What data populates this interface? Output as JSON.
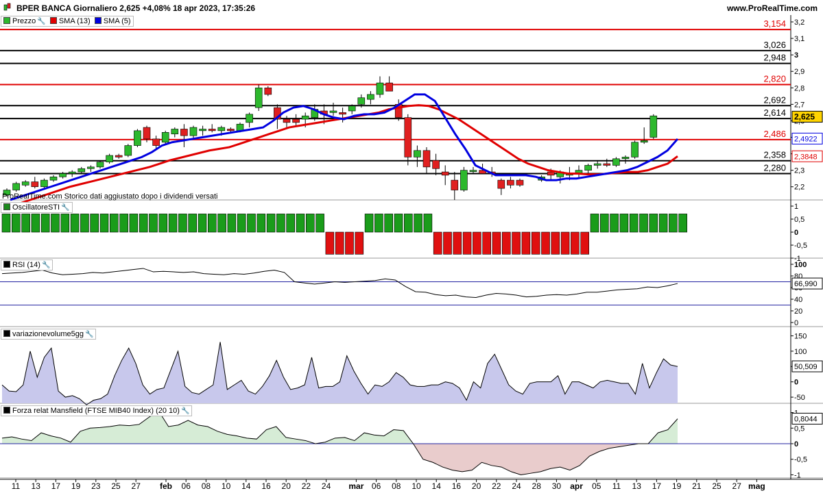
{
  "header": {
    "title": "BPER BANCA Giornaliero 2,625 +4,08% 18 apr 2023, 17:35:26",
    "site": "www.ProRealTime.com"
  },
  "price_panel": {
    "legend": [
      {
        "label": "Prezzo",
        "color": "#1b8a1b"
      },
      {
        "label": "SMA (13)",
        "color": "#e00000"
      },
      {
        "label": "SMA (5)",
        "color": "#0000e0"
      }
    ],
    "note": "ProRealTime.com Storico dati aggiustato dopo i dividendi versati",
    "levels": [
      {
        "value": 3.154,
        "label": "3,154",
        "color": "#e00000"
      },
      {
        "value": 3.026,
        "label": "3,026",
        "color": "#000000"
      },
      {
        "value": 2.948,
        "label": "2,948",
        "color": "#000000"
      },
      {
        "value": 2.82,
        "label": "2,820",
        "color": "#e00000"
      },
      {
        "value": 2.692,
        "label": "2,692",
        "color": "#000000"
      },
      {
        "value": 2.614,
        "label": "2,614",
        "color": "#000000"
      },
      {
        "value": 2.486,
        "label": "2,486",
        "color": "#e00000"
      },
      {
        "value": 2.358,
        "label": "2,358",
        "color": "#000000"
      },
      {
        "value": 2.28,
        "label": "2,280",
        "color": "#000000"
      }
    ],
    "y_ticks": [
      "3,2",
      "3,1",
      "3",
      "2,9",
      "2,8",
      "2,7",
      "2,6",
      "2,5",
      "2,4",
      "2,3",
      "2,2"
    ],
    "y_tick_values": [
      3.2,
      3.1,
      3.0,
      2.9,
      2.8,
      2.7,
      2.6,
      2.5,
      2.4,
      2.3,
      2.2
    ],
    "badges": [
      {
        "label": "2,625",
        "value": 2.625,
        "kind": "price"
      },
      {
        "label": "2,4922",
        "value": 2.4922,
        "kind": "sma5"
      },
      {
        "label": "2,3848",
        "value": 2.3848,
        "kind": "sma13"
      }
    ]
  },
  "sti_panel": {
    "legend": "OscillatoreSTI",
    "y_ticks": [
      "1",
      "0,5",
      "0",
      "-0,5",
      "-1"
    ],
    "y_tick_values": [
      1,
      0.5,
      0,
      -0.5,
      -1
    ]
  },
  "rsi_panel": {
    "legend": "RSI (14)",
    "y_ticks": [
      "100",
      "80",
      "60",
      "40",
      "20",
      "0"
    ],
    "y_tick_values": [
      100,
      80,
      60,
      40,
      20,
      0
    ],
    "badge": "66,990",
    "badge_value": 66.99
  },
  "vol_panel": {
    "legend": "variazionevolume5gg",
    "y_ticks": [
      "150",
      "100",
      "50",
      "0",
      "-50"
    ],
    "y_tick_values": [
      150,
      100,
      50,
      0,
      -50
    ],
    "badge": "50,509",
    "badge_value": 50.509
  },
  "mansfield_panel": {
    "legend": "Forza relat Mansfield (FTSE MIB40 Index) (20 10)",
    "y_ticks": [
      "1",
      "0,5",
      "0",
      "-0,5",
      "-1"
    ],
    "y_tick_values": [
      1,
      0.5,
      0,
      -0.5,
      -1
    ],
    "badge": "0,8044",
    "badge_value": 0.8044
  },
  "x_axis": {
    "ticks": [
      {
        "label": "11",
        "i": 0
      },
      {
        "label": "13",
        "i": 2
      },
      {
        "label": "17",
        "i": 4
      },
      {
        "label": "19",
        "i": 6
      },
      {
        "label": "23",
        "i": 8
      },
      {
        "label": "25",
        "i": 10
      },
      {
        "label": "27",
        "i": 12
      },
      {
        "label": "feb",
        "i": 15,
        "bold": true
      },
      {
        "label": "06",
        "i": 17
      },
      {
        "label": "08",
        "i": 19
      },
      {
        "label": "10",
        "i": 21
      },
      {
        "label": "14",
        "i": 23
      },
      {
        "label": "16",
        "i": 25
      },
      {
        "label": "20",
        "i": 27
      },
      {
        "label": "22",
        "i": 29
      },
      {
        "label": "24",
        "i": 31
      },
      {
        "label": "mar",
        "i": 34,
        "bold": true
      },
      {
        "label": "06",
        "i": 36
      },
      {
        "label": "08",
        "i": 38
      },
      {
        "label": "10",
        "i": 40
      },
      {
        "label": "14",
        "i": 42
      },
      {
        "label": "16",
        "i": 44
      },
      {
        "label": "20",
        "i": 46
      },
      {
        "label": "22",
        "i": 48
      },
      {
        "label": "24",
        "i": 50
      },
      {
        "label": "28",
        "i": 52
      },
      {
        "label": "30",
        "i": 54
      },
      {
        "label": "apr",
        "i": 56,
        "bold": true
      },
      {
        "label": "05",
        "i": 58
      },
      {
        "label": "11",
        "i": 60
      },
      {
        "label": "13",
        "i": 62
      },
      {
        "label": "17",
        "i": 64
      },
      {
        "label": "19",
        "i": 66
      },
      {
        "label": "21",
        "i": 68
      },
      {
        "label": "25",
        "i": 70
      },
      {
        "label": "27",
        "i": 72
      },
      {
        "label": "mag",
        "i": 74,
        "bold": true
      }
    ]
  },
  "colors": {
    "up": "#2db82d",
    "down": "#e02020",
    "sma13": "#e00000",
    "sma5": "#0000e0"
  },
  "chart_data": [
    {
      "type": "candlestick",
      "title": "BPER BANCA Giornaliero",
      "ylim": [
        2.12,
        3.2
      ],
      "ohlc": [
        [
          2.15,
          2.19,
          2.14,
          2.18
        ],
        [
          2.18,
          2.23,
          2.17,
          2.22
        ],
        [
          2.21,
          2.24,
          2.2,
          2.23
        ],
        [
          2.23,
          2.26,
          2.19,
          2.2
        ],
        [
          2.2,
          2.25,
          2.19,
          2.24
        ],
        [
          2.24,
          2.27,
          2.23,
          2.26
        ],
        [
          2.26,
          2.29,
          2.25,
          2.28
        ],
        [
          2.28,
          2.3,
          2.26,
          2.29
        ],
        [
          2.29,
          2.32,
          2.28,
          2.31
        ],
        [
          2.31,
          2.33,
          2.29,
          2.32
        ],
        [
          2.32,
          2.36,
          2.31,
          2.35
        ],
        [
          2.35,
          2.4,
          2.34,
          2.39
        ],
        [
          2.39,
          2.4,
          2.37,
          2.38
        ],
        [
          2.39,
          2.46,
          2.38,
          2.45
        ],
        [
          2.45,
          2.55,
          2.44,
          2.54
        ],
        [
          2.56,
          2.57,
          2.47,
          2.49
        ],
        [
          2.49,
          2.51,
          2.43,
          2.45
        ],
        [
          2.47,
          2.54,
          2.46,
          2.53
        ],
        [
          2.52,
          2.56,
          2.5,
          2.55
        ],
        [
          2.55,
          2.58,
          2.44,
          2.51
        ],
        [
          2.51,
          2.57,
          2.49,
          2.56
        ],
        [
          2.54,
          2.57,
          2.51,
          2.55
        ],
        [
          2.55,
          2.58,
          2.53,
          2.54
        ],
        [
          2.54,
          2.57,
          2.51,
          2.56
        ],
        [
          2.55,
          2.56,
          2.53,
          2.54
        ],
        [
          2.54,
          2.59,
          2.53,
          2.58
        ],
        [
          2.59,
          2.65,
          2.56,
          2.64
        ],
        [
          2.68,
          2.82,
          2.66,
          2.8
        ],
        [
          2.8,
          2.81,
          2.75,
          2.76
        ],
        [
          2.68,
          2.7,
          2.55,
          2.61
        ],
        [
          2.61,
          2.63,
          2.56,
          2.59
        ],
        [
          2.61,
          2.64,
          2.57,
          2.59
        ],
        [
          2.61,
          2.65,
          2.56,
          2.63
        ],
        [
          2.62,
          2.7,
          2.6,
          2.67
        ],
        [
          2.66,
          2.7,
          2.58,
          2.64
        ],
        [
          2.65,
          2.71,
          2.63,
          2.66
        ],
        [
          2.65,
          2.68,
          2.59,
          2.64
        ],
        [
          2.66,
          2.7,
          2.64,
          2.69
        ],
        [
          2.7,
          2.76,
          2.68,
          2.74
        ],
        [
          2.73,
          2.78,
          2.7,
          2.76
        ],
        [
          2.76,
          2.87,
          2.74,
          2.83
        ],
        [
          2.83,
          2.87,
          2.79,
          2.78
        ],
        [
          2.7,
          2.73,
          2.6,
          2.62
        ],
        [
          2.62,
          2.64,
          2.33,
          2.38
        ],
        [
          2.38,
          2.45,
          2.32,
          2.42
        ],
        [
          2.42,
          2.44,
          2.28,
          2.32
        ],
        [
          2.36,
          2.4,
          2.27,
          2.31
        ],
        [
          2.29,
          2.33,
          2.21,
          2.27
        ],
        [
          2.24,
          2.29,
          2.12,
          2.18
        ],
        [
          2.18,
          2.32,
          2.17,
          2.3
        ],
        [
          2.3,
          2.32,
          2.28,
          2.3
        ],
        [
          2.3,
          2.34,
          2.28,
          2.28
        ],
        [
          2.29,
          2.32,
          2.26,
          2.28
        ],
        [
          2.24,
          2.25,
          2.15,
          2.19
        ],
        [
          2.24,
          2.26,
          2.19,
          2.21
        ],
        [
          2.24,
          2.25,
          2.2,
          2.21
        ]
      ],
      "ohlc2": [
        [
          2.24,
          2.27,
          2.23,
          2.26
        ],
        [
          2.29,
          2.31,
          2.24,
          2.27
        ],
        [
          2.26,
          2.3,
          2.22,
          2.29
        ],
        [
          2.27,
          2.32,
          2.24,
          2.28
        ],
        [
          2.28,
          2.33,
          2.25,
          2.3
        ],
        [
          2.3,
          2.34,
          2.28,
          2.33
        ],
        [
          2.33,
          2.36,
          2.31,
          2.34
        ],
        [
          2.34,
          2.37,
          2.32,
          2.33
        ],
        [
          2.33,
          2.38,
          2.32,
          2.37
        ],
        [
          2.37,
          2.39,
          2.34,
          2.38
        ],
        [
          2.38,
          2.48,
          2.37,
          2.47
        ],
        [
          2.47,
          2.56,
          2.46,
          2.48
        ],
        [
          2.5,
          2.64,
          2.49,
          2.63
        ]
      ],
      "sma13": [
        2.08,
        2.1,
        2.12,
        2.14,
        2.16,
        2.18,
        2.2,
        2.215,
        2.23,
        2.245,
        2.26,
        2.275,
        2.29,
        2.305,
        2.32,
        2.34,
        2.36,
        2.375,
        2.39,
        2.405,
        2.42,
        2.43,
        2.44,
        2.46,
        2.48,
        2.5,
        2.52,
        2.54,
        2.56,
        2.57,
        2.58,
        2.59,
        2.6,
        2.61,
        2.62,
        2.63,
        2.64,
        2.65,
        2.67,
        2.68,
        2.69,
        2.695,
        2.69,
        2.67,
        2.64,
        2.61,
        2.57,
        2.53,
        2.49,
        2.45,
        2.41,
        2.37,
        2.34,
        2.32,
        2.3,
        2.29,
        2.28,
        2.28,
        2.275,
        2.275,
        2.28,
        2.285,
        2.29,
        2.29,
        2.3,
        2.32,
        2.34,
        2.385
      ],
      "sma5": [
        2.12,
        2.14,
        2.16,
        2.18,
        2.2,
        2.22,
        2.24,
        2.26,
        2.28,
        2.3,
        2.32,
        2.34,
        2.36,
        2.38,
        2.41,
        2.45,
        2.47,
        2.48,
        2.49,
        2.5,
        2.51,
        2.52,
        2.53,
        2.54,
        2.55,
        2.56,
        2.6,
        2.65,
        2.68,
        2.69,
        2.67,
        2.64,
        2.62,
        2.61,
        2.63,
        2.64,
        2.64,
        2.65,
        2.68,
        2.72,
        2.76,
        2.76,
        2.72,
        2.62,
        2.52,
        2.43,
        2.33,
        2.3,
        2.27,
        2.27,
        2.27,
        2.27,
        2.26,
        2.24,
        2.24,
        2.25,
        2.25,
        2.26,
        2.27,
        2.28,
        2.29,
        2.3,
        2.32,
        2.35,
        2.38,
        2.42,
        2.49
      ]
    },
    {
      "type": "bar",
      "title": "OscillatoreSTI",
      "ylim": [
        -1,
        1
      ],
      "values": [
        0.7,
        0.7,
        0.7,
        0.7,
        0.7,
        0.7,
        0.7,
        0.7,
        0.7,
        0.7,
        0.7,
        0.7,
        0.7,
        0.7,
        0.7,
        0.7,
        0.7,
        0.7,
        0.7,
        0.7,
        0.7,
        0.7,
        0.7,
        0.7,
        0.7,
        0.7,
        0.7,
        0.7,
        0.7,
        0.7,
        0.7,
        0.7,
        0.7,
        -0.85,
        -0.85,
        -0.85,
        -0.85,
        0.7,
        0.7,
        0.7,
        0.7,
        0.7,
        0.7,
        0.7,
        -0.85,
        -0.85,
        -0.85,
        -0.85,
        -0.85,
        -0.85,
        -0.85,
        -0.85,
        -0.85,
        -0.85,
        -0.85,
        -0.85,
        -0.85,
        -0.85,
        -0.85,
        -0.85,
        0.7,
        0.7,
        0.7,
        0.7,
        0.7,
        0.7,
        0.7,
        0.7,
        0.7,
        0.7
      ]
    },
    {
      "type": "line",
      "title": "RSI (14)",
      "ylim": [
        0,
        100
      ],
      "values": [
        84,
        85,
        86,
        88,
        90,
        85,
        82,
        83,
        84,
        86,
        85,
        87,
        89,
        91,
        93,
        87,
        88,
        87,
        86,
        87,
        84,
        83,
        82,
        84,
        83,
        85,
        88,
        90,
        86,
        70,
        68,
        66,
        68,
        70,
        69,
        70,
        71,
        72,
        75,
        73,
        62,
        53,
        52,
        48,
        46,
        47,
        44,
        43,
        47,
        50,
        49,
        47,
        44,
        45,
        47,
        48,
        47,
        49,
        52,
        52,
        54,
        56,
        57,
        58,
        61,
        60,
        63,
        67
      ]
    },
    {
      "type": "area",
      "title": "variazionevolume5gg",
      "ylim": [
        -70,
        160
      ],
      "values": [
        -10,
        -30,
        -32,
        -10,
        100,
        15,
        80,
        110,
        -30,
        -50,
        -45,
        -55,
        -75,
        -60,
        -55,
        -40,
        20,
        70,
        110,
        60,
        -10,
        -40,
        -25,
        -20,
        40,
        100,
        -15,
        -35,
        -40,
        -25,
        -10,
        130,
        -25,
        -10,
        5,
        -30,
        -40,
        -15,
        20,
        70,
        15,
        -25,
        -20,
        -10,
        80,
        -20,
        -15,
        -15,
        0,
        85,
        35,
        -5,
        -40,
        -10,
        -15,
        0,
        30,
        15,
        -10,
        -15,
        -15,
        -10,
        -10,
        0,
        -5,
        -20,
        -60,
        0,
        -20,
        60,
        90,
        40,
        -10,
        -30,
        -40,
        -5,
        0,
        0,
        0,
        20,
        -40,
        0,
        0,
        -10,
        -20,
        0,
        5,
        0,
        -5,
        -5,
        -40,
        60,
        -20,
        30,
        75,
        55,
        50
      ]
    },
    {
      "type": "area",
      "title": "Forza relat Mansfield (FTSE MIB40 Index) (20 10)",
      "ylim": [
        -1.1,
        1.1
      ],
      "values": [
        0.18,
        0.22,
        0.15,
        0.1,
        0.35,
        0.25,
        0.18,
        0.05,
        0.4,
        0.5,
        0.52,
        0.55,
        0.6,
        0.58,
        0.62,
        0.85,
        1.05,
        0.55,
        0.6,
        0.75,
        0.6,
        0.55,
        0.4,
        0.3,
        0.25,
        0.18,
        0.15,
        0.45,
        0.55,
        0.2,
        0.15,
        0.1,
        0.0,
        0.05,
        0.18,
        0.2,
        0.1,
        0.35,
        0.28,
        0.25,
        0.45,
        0.42,
        0.0,
        -0.5,
        -0.6,
        -0.75,
        -0.85,
        -0.9,
        -0.85,
        -0.6,
        -0.7,
        -0.75,
        -0.9,
        -1.0,
        -0.95,
        -0.9,
        -0.8,
        -0.75,
        -0.85,
        -0.7,
        -0.4,
        -0.25,
        -0.15,
        -0.1,
        -0.05,
        0.0,
        0.0,
        0.35,
        0.45,
        0.8
      ]
    }
  ]
}
